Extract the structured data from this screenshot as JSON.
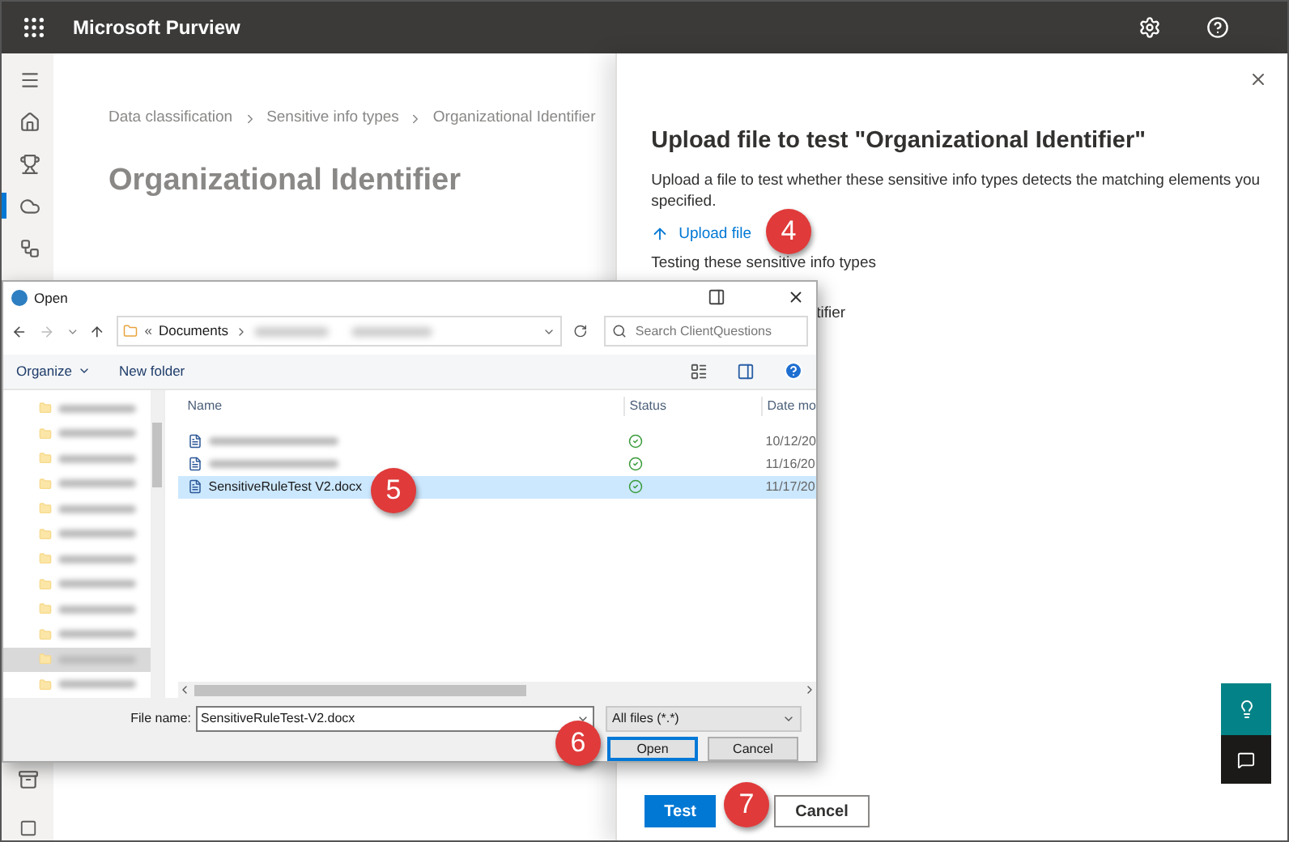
{
  "top_bar": {
    "title": "Microsoft Purview"
  },
  "left_rail": {
    "items": [
      {
        "selected": false
      },
      {
        "selected": false
      },
      {
        "selected": false
      },
      {
        "selected": true
      },
      {
        "selected": false
      }
    ]
  },
  "page": {
    "breadcrumb": [
      "Data classification",
      "Sensitive info types",
      "Organizational Identifier"
    ],
    "title": "Organizational Identifier"
  },
  "panel": {
    "title": "Upload file to test \"Organizational Identifier\"",
    "description": "Upload a file to test whether these sensitive info types detects the matching elements you specified.",
    "upload_link": "Upload file",
    "section_label": "Testing these sensitive info types",
    "partial_item": "tifier",
    "buttons": [
      {
        "label": "Test",
        "primary": true
      },
      {
        "label": "Cancel",
        "primary": false
      }
    ]
  },
  "dialog": {
    "title": "Open",
    "path_prefix": "«",
    "path": "Documents",
    "search_placeholder": "Search ClientQuestions",
    "toolbar": [
      "Organize",
      "New folder"
    ],
    "nav_items": [
      {
        "selected": false
      },
      {
        "selected": false
      },
      {
        "selected": false
      },
      {
        "selected": false
      },
      {
        "selected": false
      },
      {
        "selected": false
      },
      {
        "selected": false
      },
      {
        "selected": false
      },
      {
        "selected": false
      },
      {
        "selected": false
      },
      {
        "selected": true
      },
      {
        "selected": false
      }
    ],
    "columns": [
      "Name",
      "Status",
      "Date mo"
    ],
    "rows": [
      {
        "kind": "redacted",
        "date": "10/12/20",
        "selected": false
      },
      {
        "kind": "redacted",
        "date": "11/16/20",
        "selected": false
      },
      {
        "kind": "file",
        "name": "SensitiveRuleTest V2.docx",
        "date": "11/17/20",
        "selected": true
      }
    ],
    "file_name_label": "File name:",
    "file_name": "SensitiveRuleTest-V2.docx",
    "file_type": "All files (*.*)",
    "buttons": [
      {
        "label": "Open",
        "focused": true
      },
      {
        "label": "Cancel",
        "focused": false
      }
    ]
  },
  "callouts": [
    "4",
    "5",
    "6",
    "7"
  ]
}
